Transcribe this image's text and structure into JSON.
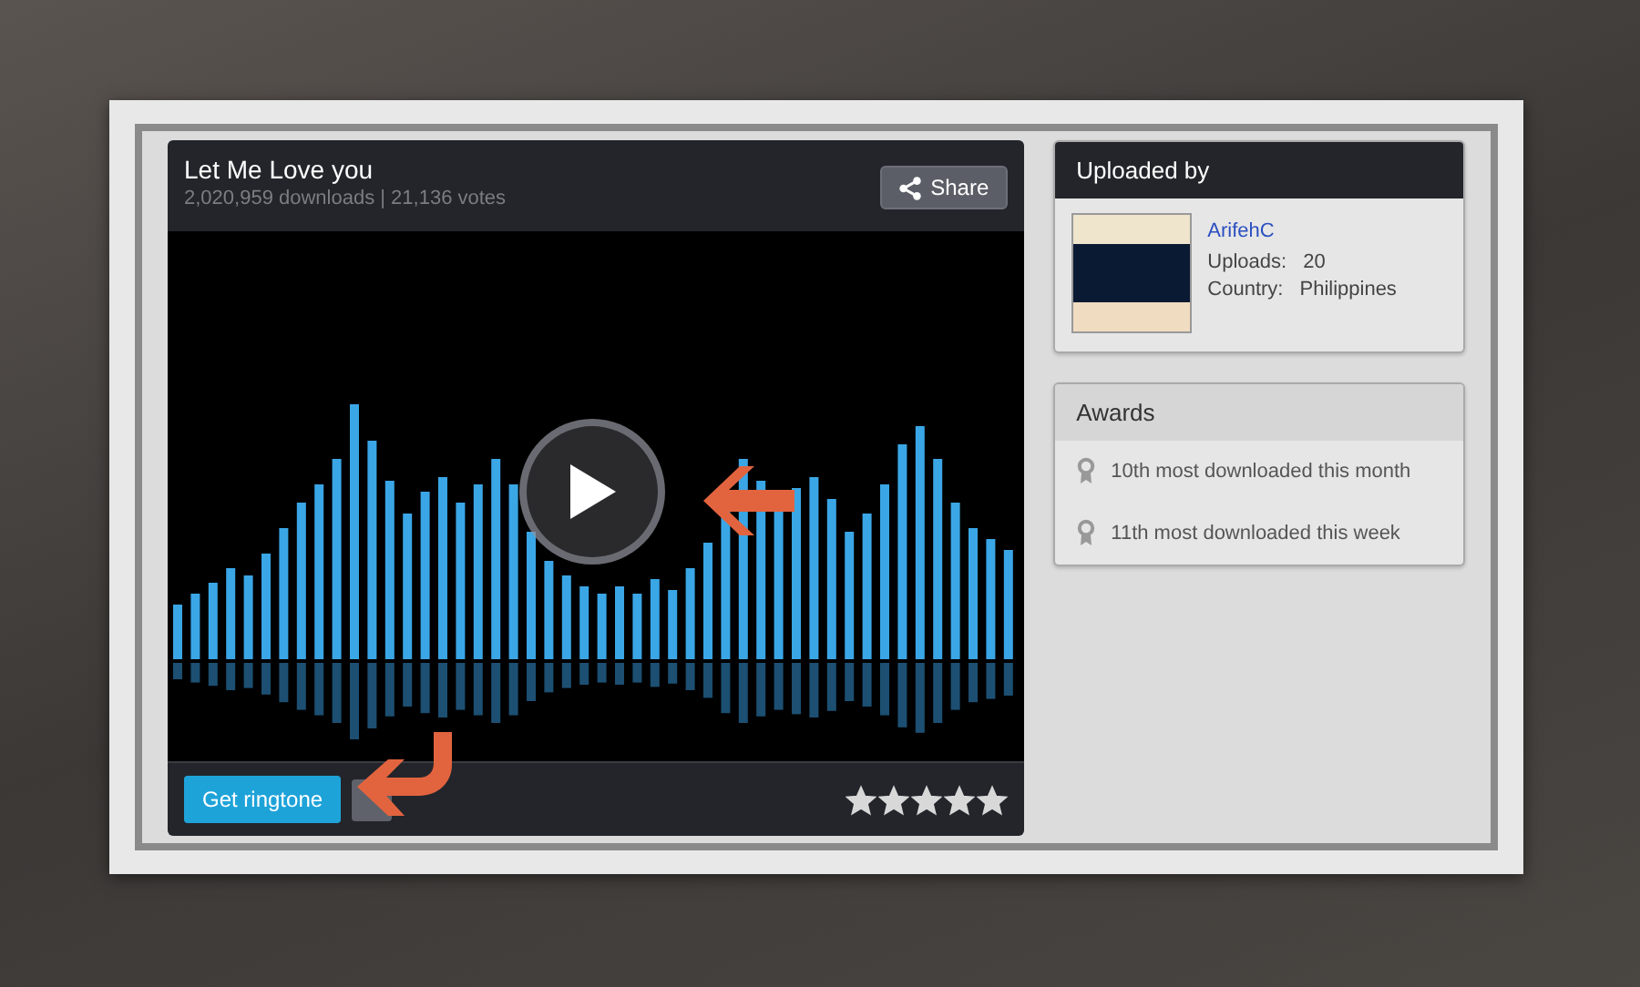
{
  "player": {
    "title": "Let Me Love you",
    "stats": "2,020,959 downloads | 21,136 votes",
    "share_label": "Share",
    "ringtone_label": "Get ringtone",
    "stars": 5
  },
  "uploader": {
    "heading": "Uploaded by",
    "name": "ArifehC",
    "fields": [
      {
        "label": "Uploads:",
        "value": "20"
      },
      {
        "label": "Country:",
        "value": "Philippines"
      }
    ]
  },
  "awards": {
    "heading": "Awards",
    "items": [
      "10th most downloaded this month",
      "11th most downloaded this week"
    ]
  }
}
